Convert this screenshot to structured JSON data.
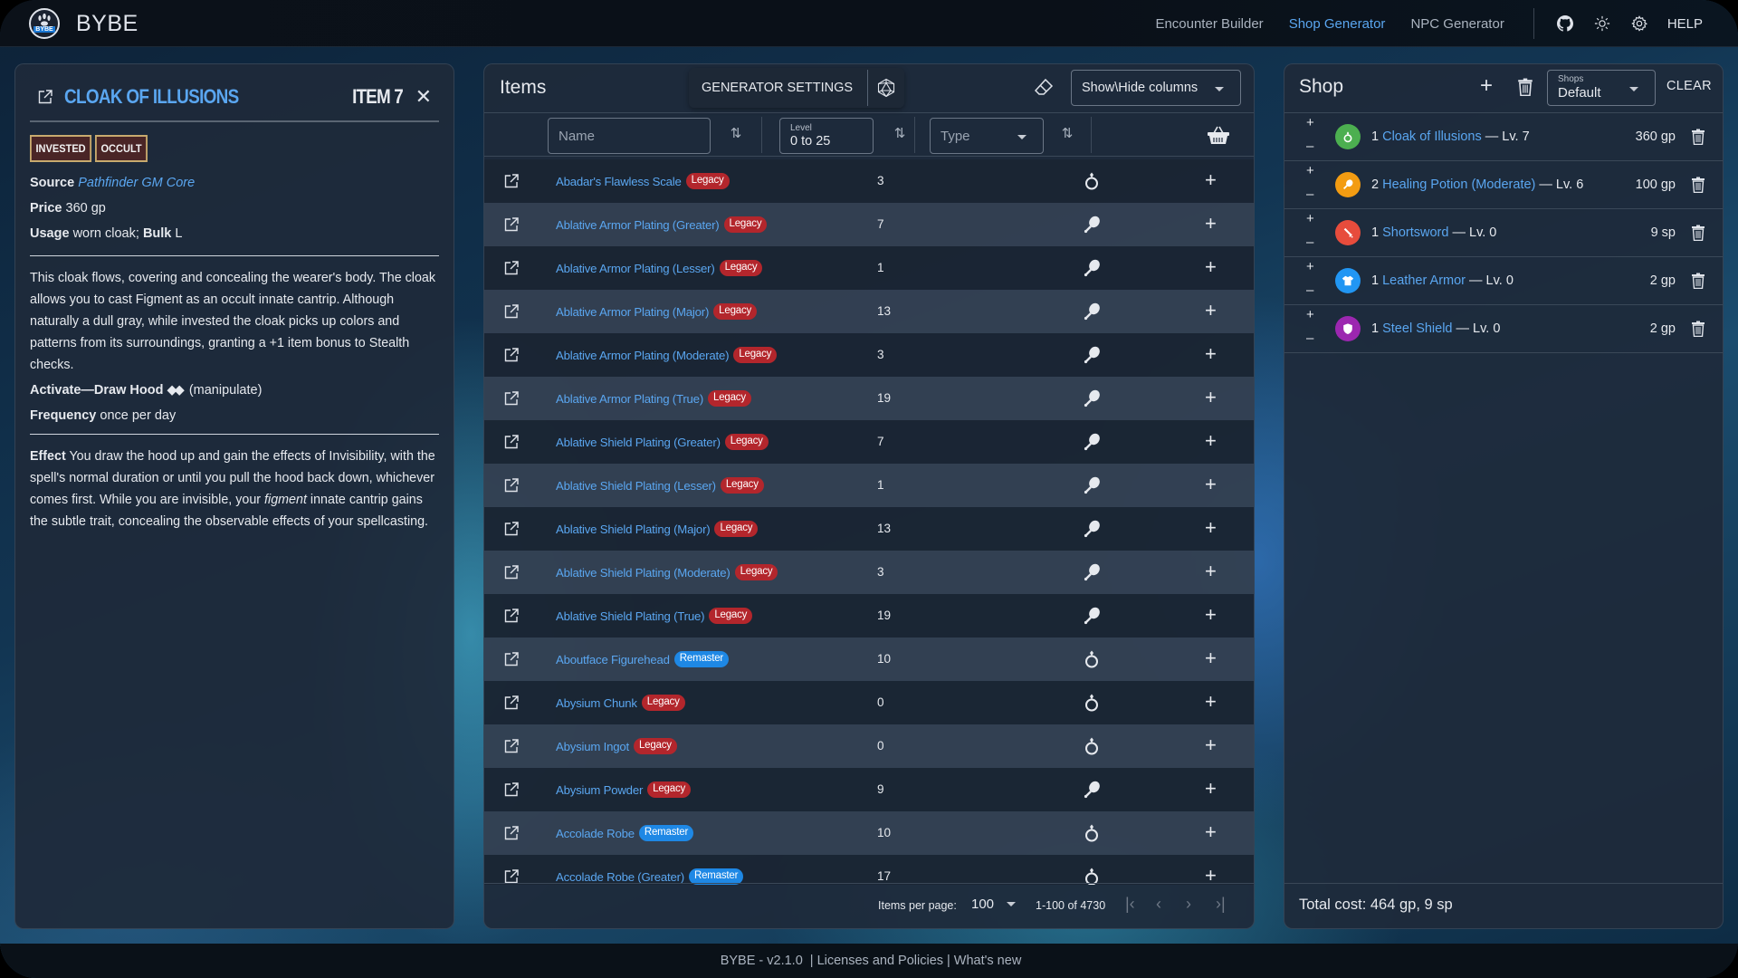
{
  "app": {
    "brand": "BYBE",
    "logo_badge": "BYBE"
  },
  "nav": {
    "links": [
      {
        "label": "Encounter Builder",
        "active": false
      },
      {
        "label": "Shop Generator",
        "active": true
      },
      {
        "label": "NPC Generator",
        "active": false
      }
    ],
    "icons": [
      "github-icon",
      "theme-toggle-icon",
      "settings-icon"
    ],
    "help_label": "HELP"
  },
  "detail": {
    "title": "CLOAK OF ILLUSIONS",
    "level_label": "ITEM 7",
    "traits": [
      "INVESTED",
      "OCCULT"
    ],
    "source_label": "Source",
    "source_value": "Pathfinder GM Core",
    "price_label": "Price",
    "price_value": "360 gp",
    "usage_label": "Usage",
    "usage_value": "worn cloak;",
    "bulk_label": "Bulk",
    "bulk_value": "L",
    "description": "This cloak flows, covering and concealing the wearer's body. The cloak allows you to cast Figment as an occult innate cantrip. Although naturally a dull gray, while invested the cloak picks up colors and patterns from its surroundings, granting a +1 item bonus to Stealth checks.",
    "activate_label": "Activate—Draw Hood",
    "activate_actions": "◆◆",
    "activate_traits": "(manipulate)",
    "frequency_label": "Frequency",
    "frequency_value": "once per day",
    "effect_label": "Effect",
    "effect_part1": "You draw the hood up and gain the effects of Invisibility, with the spell's normal duration or until you pull the hood back down, whichever comes first. While you are invisible, your",
    "effect_italic": "figment",
    "effect_part2": "innate cantrip gains the subtle trait, concealing the observable effects of your spellcasting."
  },
  "items": {
    "title": "Items",
    "generator_settings_label": "GENERATOR SETTINGS",
    "show_hide_columns_label": "Show\\Hide columns",
    "filters": {
      "name_placeholder": "Name",
      "level_label": "Level",
      "level_value": "0 to 25",
      "type_placeholder": "Type"
    },
    "rows": [
      {
        "name": "Abadar's Flawless Scale",
        "tag": "Legacy",
        "level": "3",
        "type": "equipment"
      },
      {
        "name": "Ablative Armor Plating (Greater)",
        "tag": "Legacy",
        "level": "7",
        "type": "consumable"
      },
      {
        "name": "Ablative Armor Plating (Lesser)",
        "tag": "Legacy",
        "level": "1",
        "type": "consumable"
      },
      {
        "name": "Ablative Armor Plating (Major)",
        "tag": "Legacy",
        "level": "13",
        "type": "consumable"
      },
      {
        "name": "Ablative Armor Plating (Moderate)",
        "tag": "Legacy",
        "level": "3",
        "type": "consumable"
      },
      {
        "name": "Ablative Armor Plating (True)",
        "tag": "Legacy",
        "level": "19",
        "type": "consumable"
      },
      {
        "name": "Ablative Shield Plating (Greater)",
        "tag": "Legacy",
        "level": "7",
        "type": "consumable"
      },
      {
        "name": "Ablative Shield Plating (Lesser)",
        "tag": "Legacy",
        "level": "1",
        "type": "consumable"
      },
      {
        "name": "Ablative Shield Plating (Major)",
        "tag": "Legacy",
        "level": "13",
        "type": "consumable"
      },
      {
        "name": "Ablative Shield Plating (Moderate)",
        "tag": "Legacy",
        "level": "3",
        "type": "consumable"
      },
      {
        "name": "Ablative Shield Plating (True)",
        "tag": "Legacy",
        "level": "19",
        "type": "consumable"
      },
      {
        "name": "Aboutface Figurehead",
        "tag": "Remaster",
        "level": "10",
        "type": "equipment"
      },
      {
        "name": "Abysium Chunk",
        "tag": "Legacy",
        "level": "0",
        "type": "equipment"
      },
      {
        "name": "Abysium Ingot",
        "tag": "Legacy",
        "level": "0",
        "type": "equipment"
      },
      {
        "name": "Abysium Powder",
        "tag": "Legacy",
        "level": "9",
        "type": "consumable"
      },
      {
        "name": "Accolade Robe",
        "tag": "Remaster",
        "level": "10",
        "type": "equipment"
      },
      {
        "name": "Accolade Robe (Greater)",
        "tag": "Remaster",
        "level": "17",
        "type": "equipment"
      }
    ],
    "pagination": {
      "items_per_page_label": "Items per page:",
      "items_per_page": "100",
      "range": "1-100 of 4730"
    }
  },
  "shop": {
    "title": "Shop",
    "shops_label": "Shops",
    "shops_value": "Default",
    "clear_label": "CLEAR",
    "entries": [
      {
        "qty": "1",
        "name": "Cloak of Illusions",
        "level": "— Lv. 7",
        "price": "360 gp",
        "icon": "ring-icon",
        "color": "#4caf50"
      },
      {
        "qty": "2",
        "name": "Healing Potion (Moderate)",
        "level": "— Lv. 6",
        "price": "100 gp",
        "icon": "potion-icon",
        "color": "#f39c12"
      },
      {
        "qty": "1",
        "name": "Shortsword",
        "level": "— Lv. 0",
        "price": "9 sp",
        "icon": "sword-icon",
        "color": "#e74c3c"
      },
      {
        "qty": "1",
        "name": "Leather Armor",
        "level": "— Lv. 0",
        "price": "2 gp",
        "icon": "armor-icon",
        "color": "#2196f3"
      },
      {
        "qty": "1",
        "name": "Steel Shield",
        "level": "— Lv. 0",
        "price": "2 gp",
        "icon": "shield-icon",
        "color": "#9c27b0"
      }
    ],
    "total": "Total cost: 464 gp, 9 sp"
  },
  "footer": {
    "version": "BYBE - v2.1.0",
    "licenses": "Licenses and Policies",
    "whats_new": "What's new",
    "separator": "|"
  },
  "colors": {
    "accent": "#5aa6f0",
    "legacy": "#b3262c",
    "remaster": "#1e88e5",
    "trait_bg": "#4a2526",
    "trait_border": "#c8aa6e"
  }
}
